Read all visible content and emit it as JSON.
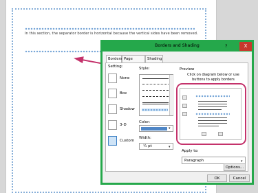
{
  "document": {
    "body_text": "In this section, the separator border is horizontal because the vertical sides have been removed."
  },
  "dialog": {
    "title": "Borders and Shading",
    "help_label": "?",
    "close_label": "X",
    "tabs": [
      {
        "label": "Borders",
        "active": true
      },
      {
        "label": "Page Border",
        "active": false
      },
      {
        "label": "Shading",
        "active": false
      }
    ],
    "setting_label": "Setting:",
    "settings": [
      {
        "label": "None"
      },
      {
        "label": "Box"
      },
      {
        "label": "Shadow"
      },
      {
        "label": "3-D"
      },
      {
        "label": "Custom",
        "selected": true
      }
    ],
    "style_label": "Style:",
    "color_label": "Color:",
    "color_value": "#4f86c6",
    "width_label": "Width:",
    "width_value": "¼ pt",
    "preview_label": "Preview",
    "preview_hint": "Click on diagram below or use buttons to apply borders",
    "apply_to_label": "Apply to:",
    "apply_to_value": "Paragraph",
    "options_label": "Options...",
    "ok_label": "OK",
    "cancel_label": "Cancel"
  },
  "colors": {
    "dialog_border": "#25a84b",
    "annotation": "#c4326b",
    "close_button": "#c8382c"
  }
}
